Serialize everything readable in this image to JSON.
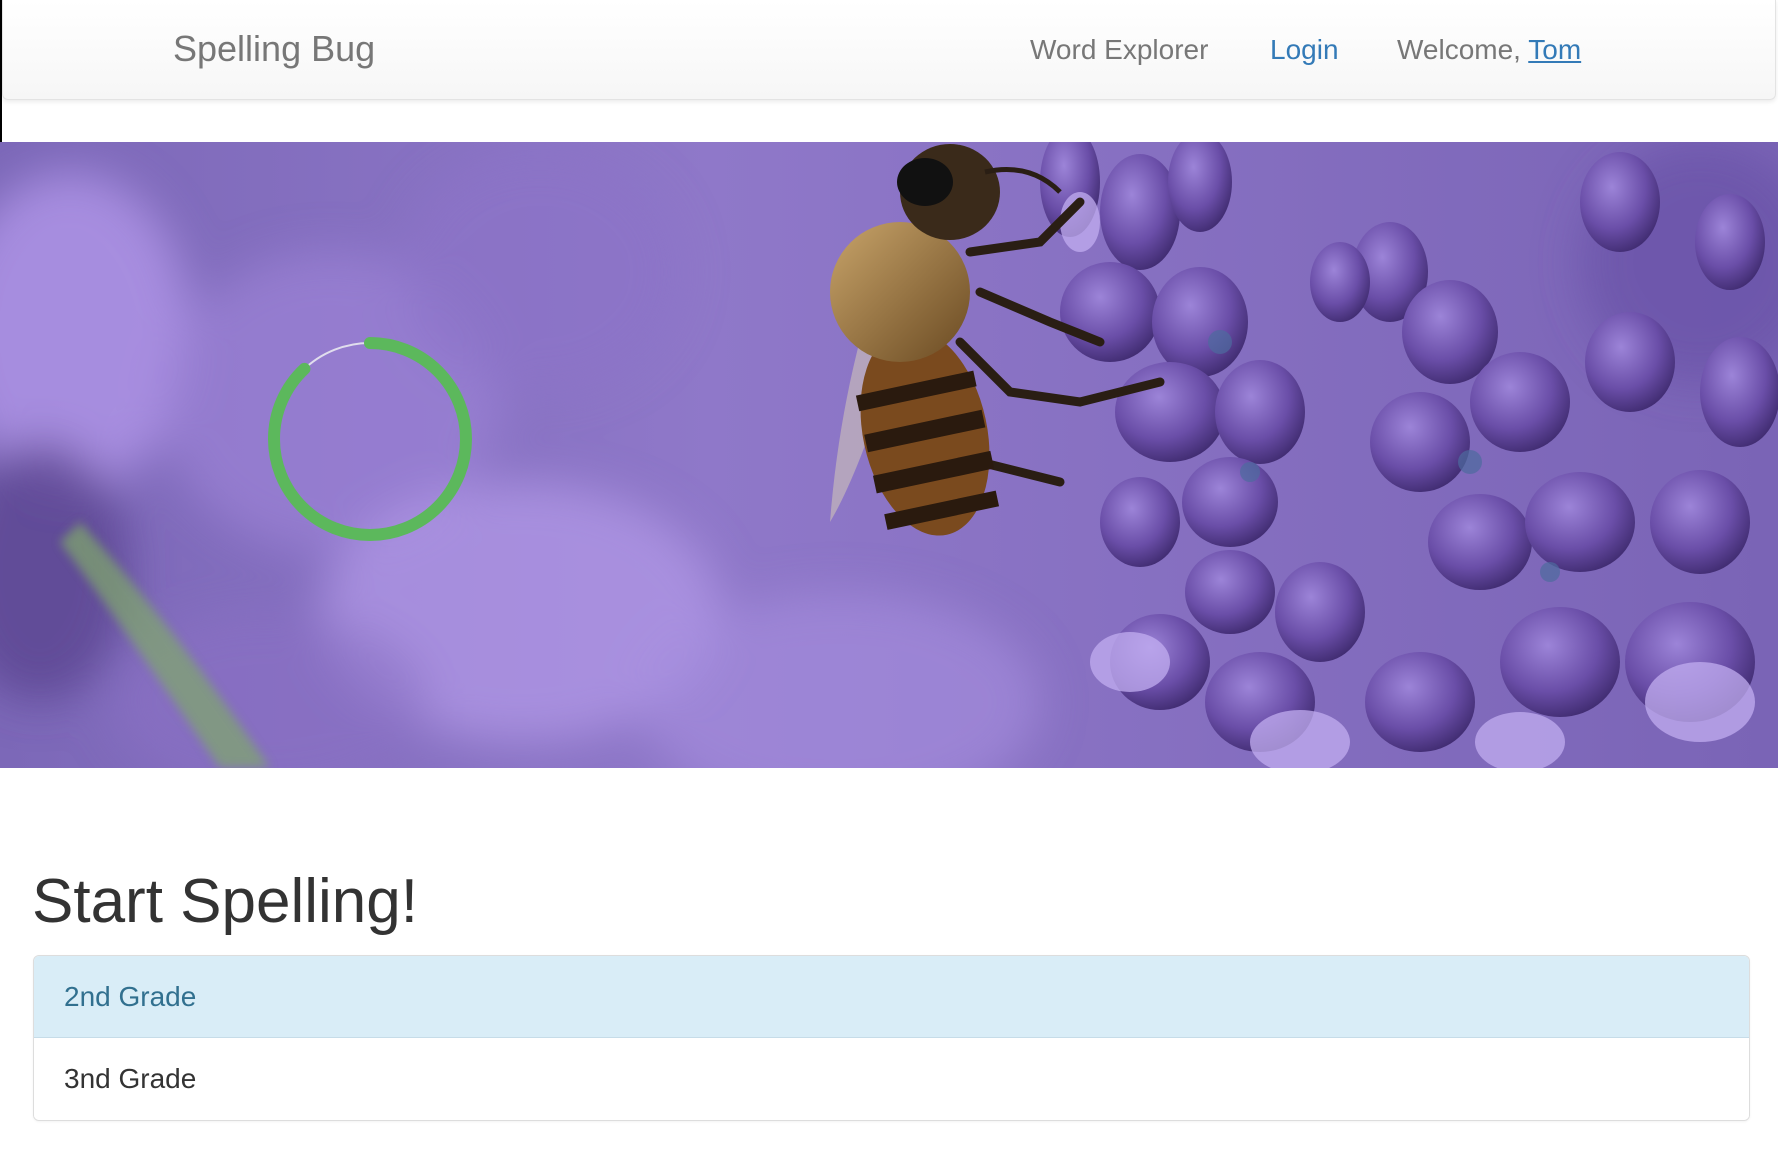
{
  "navbar": {
    "brand": "Spelling Bug",
    "links": {
      "word_explorer": "Word Explorer",
      "login": "Login",
      "welcome_prefix": "Welcome, ",
      "welcome_user": "Tom"
    }
  },
  "hero": {
    "progress_fraction": 0.88,
    "progress_color": "#5cb85c"
  },
  "main": {
    "title": "Start Spelling!",
    "grades": [
      {
        "label": "2nd Grade"
      },
      {
        "label": "3nd Grade"
      }
    ]
  },
  "colors": {
    "link": "#337ab7",
    "active_bg": "#d9edf7",
    "active_text": "#31708f"
  }
}
